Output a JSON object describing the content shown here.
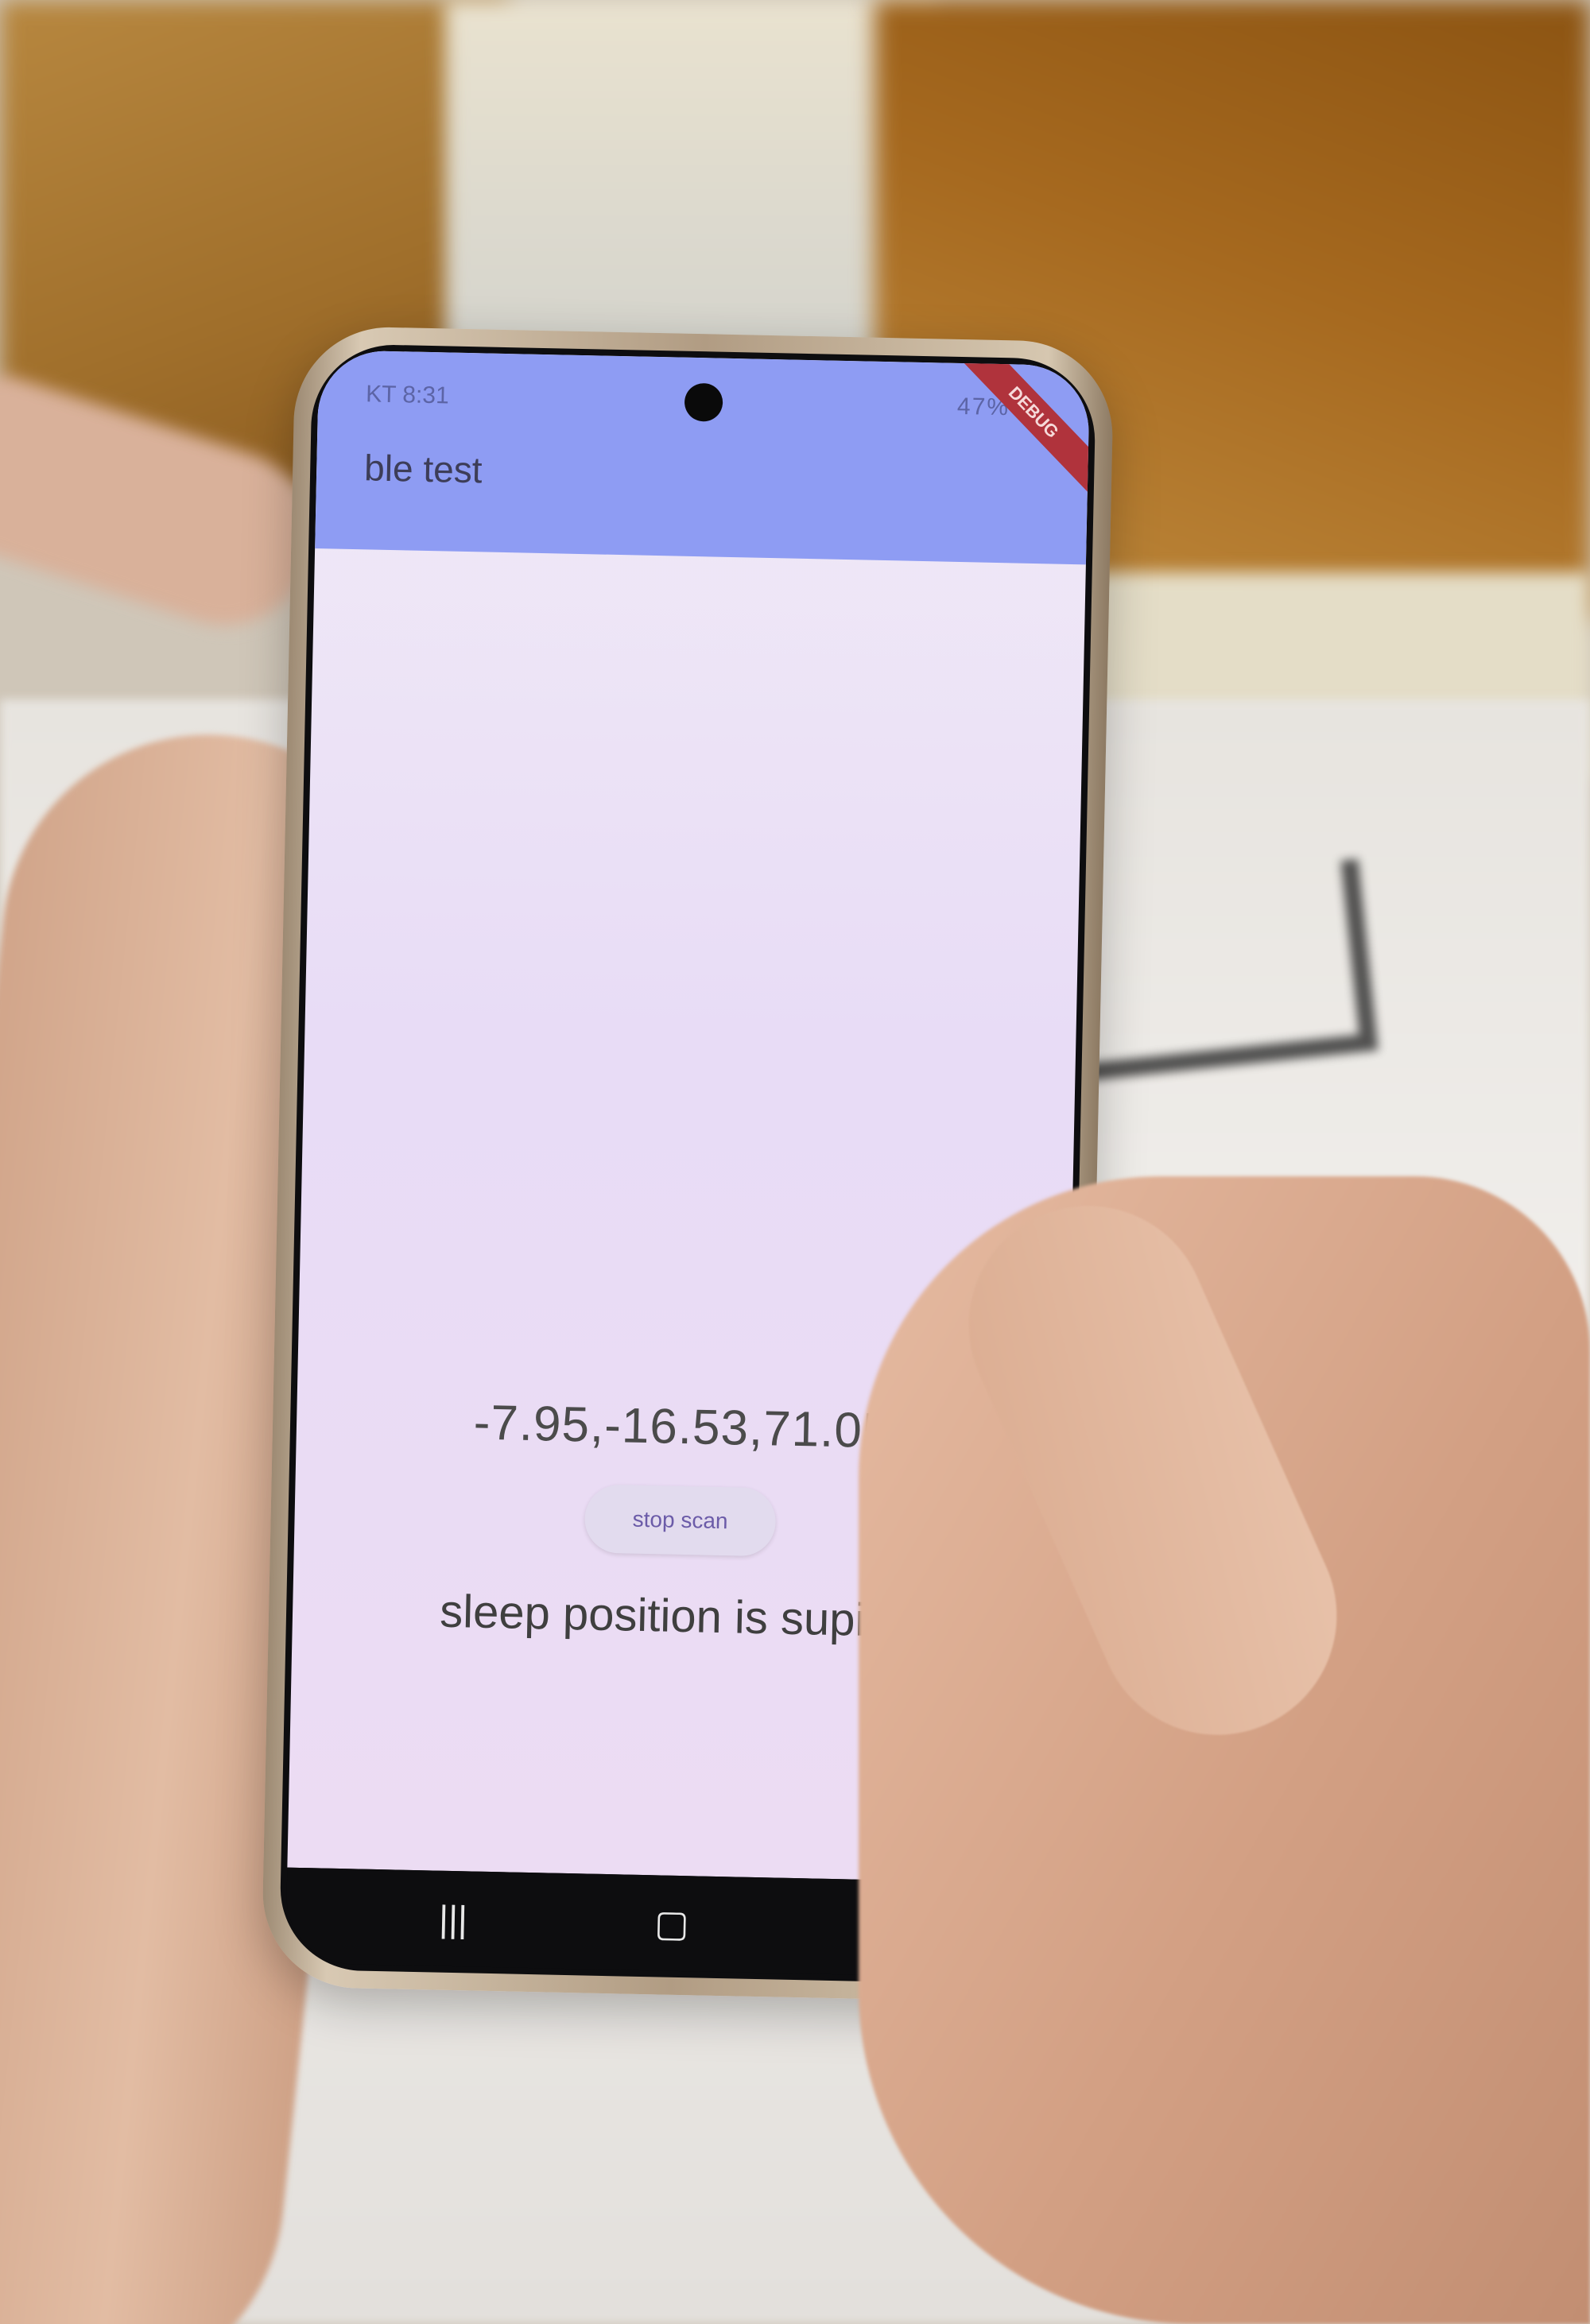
{
  "status_bar": {
    "left": "KT 8:31",
    "right": "47%"
  },
  "debug_banner": "DEBUG",
  "app": {
    "title": "ble test",
    "readout": "-7.95,-16.53,71.05",
    "stop_button_label": "stop scan",
    "sleep_text": "sleep position is supine",
    "fab_icon": "+"
  },
  "navigation": {
    "recent_icon": "recent-apps-icon",
    "home_icon": "home-icon",
    "back_icon": "back-icon"
  },
  "colors": {
    "appbar": "#8e9cf3",
    "accent": "#6b5ba8"
  }
}
